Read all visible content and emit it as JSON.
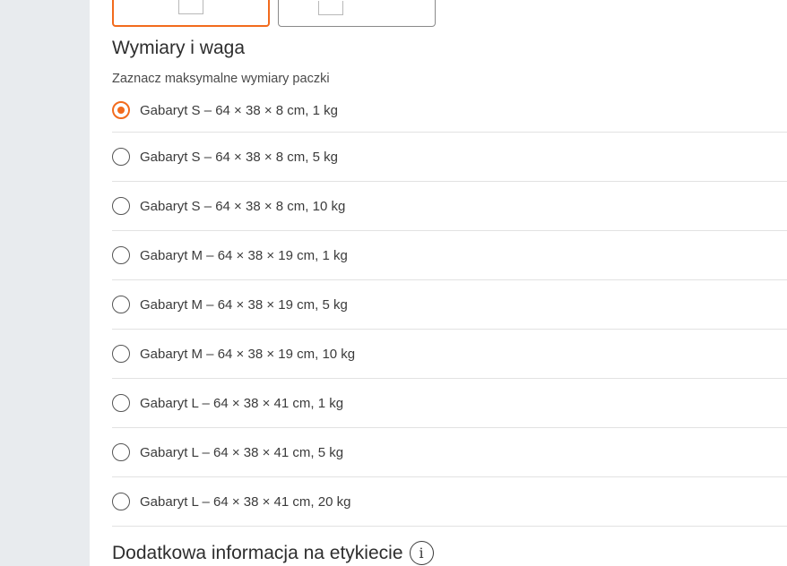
{
  "cards": {
    "selected_icon": "parcel-box-icon",
    "unselected_icon": "parcel-box-icon"
  },
  "dimensions": {
    "title": "Wymiary i waga",
    "subtitle": "Zaznacz maksymalne wymiary paczki",
    "options": [
      {
        "label": "Gabaryt S – 64 × 38 × 8 cm, 1 kg",
        "checked": true
      },
      {
        "label": "Gabaryt S – 64 × 38 × 8 cm, 5 kg",
        "checked": false
      },
      {
        "label": "Gabaryt S – 64 × 38 × 8 cm, 10 kg",
        "checked": false
      },
      {
        "label": "Gabaryt M – 64 × 38 × 19 cm, 1 kg",
        "checked": false
      },
      {
        "label": "Gabaryt M – 64 × 38 × 19 cm, 5 kg",
        "checked": false
      },
      {
        "label": "Gabaryt M – 64 × 38 × 19 cm, 10 kg",
        "checked": false
      },
      {
        "label": "Gabaryt L – 64 × 38 × 41 cm, 1 kg",
        "checked": false
      },
      {
        "label": "Gabaryt L – 64 × 38 × 41 cm, 5 kg",
        "checked": false
      },
      {
        "label": "Gabaryt L – 64 × 38 × 41 cm, 20 kg",
        "checked": false
      }
    ]
  },
  "extra_info": {
    "title": "Dodatkowa informacja na etykiecie",
    "info_glyph": "i",
    "icon": "info-icon"
  },
  "colors": {
    "accent": "#f26b1d",
    "sidebar_bg": "#e8ebee",
    "divider": "#e2e2e2"
  }
}
